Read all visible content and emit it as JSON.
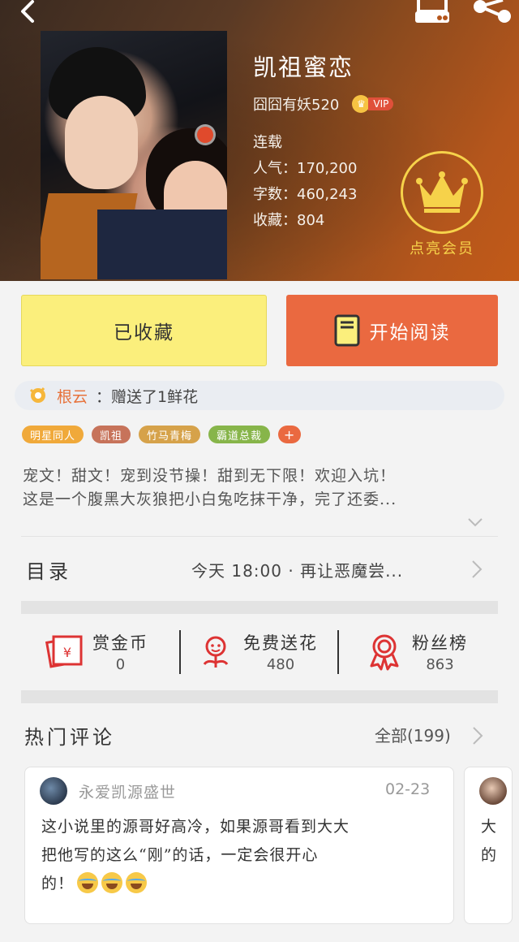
{
  "book": {
    "title": "凯祖蜜恋",
    "author": "囧囧有妖520",
    "vip_label": "VIP",
    "status": "连载",
    "popularity_line": "人气：170,200",
    "words_line": "字数：460,243",
    "favorites_line": "收藏：804"
  },
  "member": {
    "label": "点亮会员"
  },
  "actions": {
    "collected_label": "已收藏",
    "read_label": "开始阅读"
  },
  "ticker": {
    "user": "根云",
    "message": "：赠送了1鲜花"
  },
  "tags": [
    {
      "label": "明星同人",
      "color": "#f0a93a"
    },
    {
      "label": "凯祖",
      "color": "#c7735a"
    },
    {
      "label": "竹马青梅",
      "color": "#d6a24a"
    },
    {
      "label": "霸道总裁",
      "color": "#87b54a"
    },
    {
      "label": "+",
      "color": "#ea6940"
    }
  ],
  "description": {
    "line1": "宠文！甜文！宠到没节操！甜到无下限！欢迎入坑！",
    "line2": "这是一个腹黑大灰狼把小白兔吃抹干净，完了还委..."
  },
  "catalog": {
    "label": "目录",
    "latest": "今天 18:00 · 再让恶魔尝..."
  },
  "stats": [
    {
      "name": "赏金币",
      "value": "0",
      "icon": "red-envelope-icon"
    },
    {
      "name": "免费送花",
      "value": "480",
      "icon": "flower-icon"
    },
    {
      "name": "粉丝榜",
      "value": "863",
      "icon": "medal-icon"
    }
  ],
  "comments": {
    "title": "热门评论",
    "all_label": "全部(199)",
    "items": [
      {
        "user": "永爱凯源盛世",
        "date": "02-23",
        "text_line1": "这小说里的源哥好高冷，如果源哥看到大大",
        "text_line2": "把他写的这么“刚”的话，一定会很开心",
        "text_line3": "的！"
      },
      {
        "text_line1": "大",
        "text_line2": "的"
      }
    ]
  },
  "colors": {
    "accent_orange": "#ea6940",
    "collect_yellow": "#fbef7c",
    "gold": "#f6d24a"
  }
}
